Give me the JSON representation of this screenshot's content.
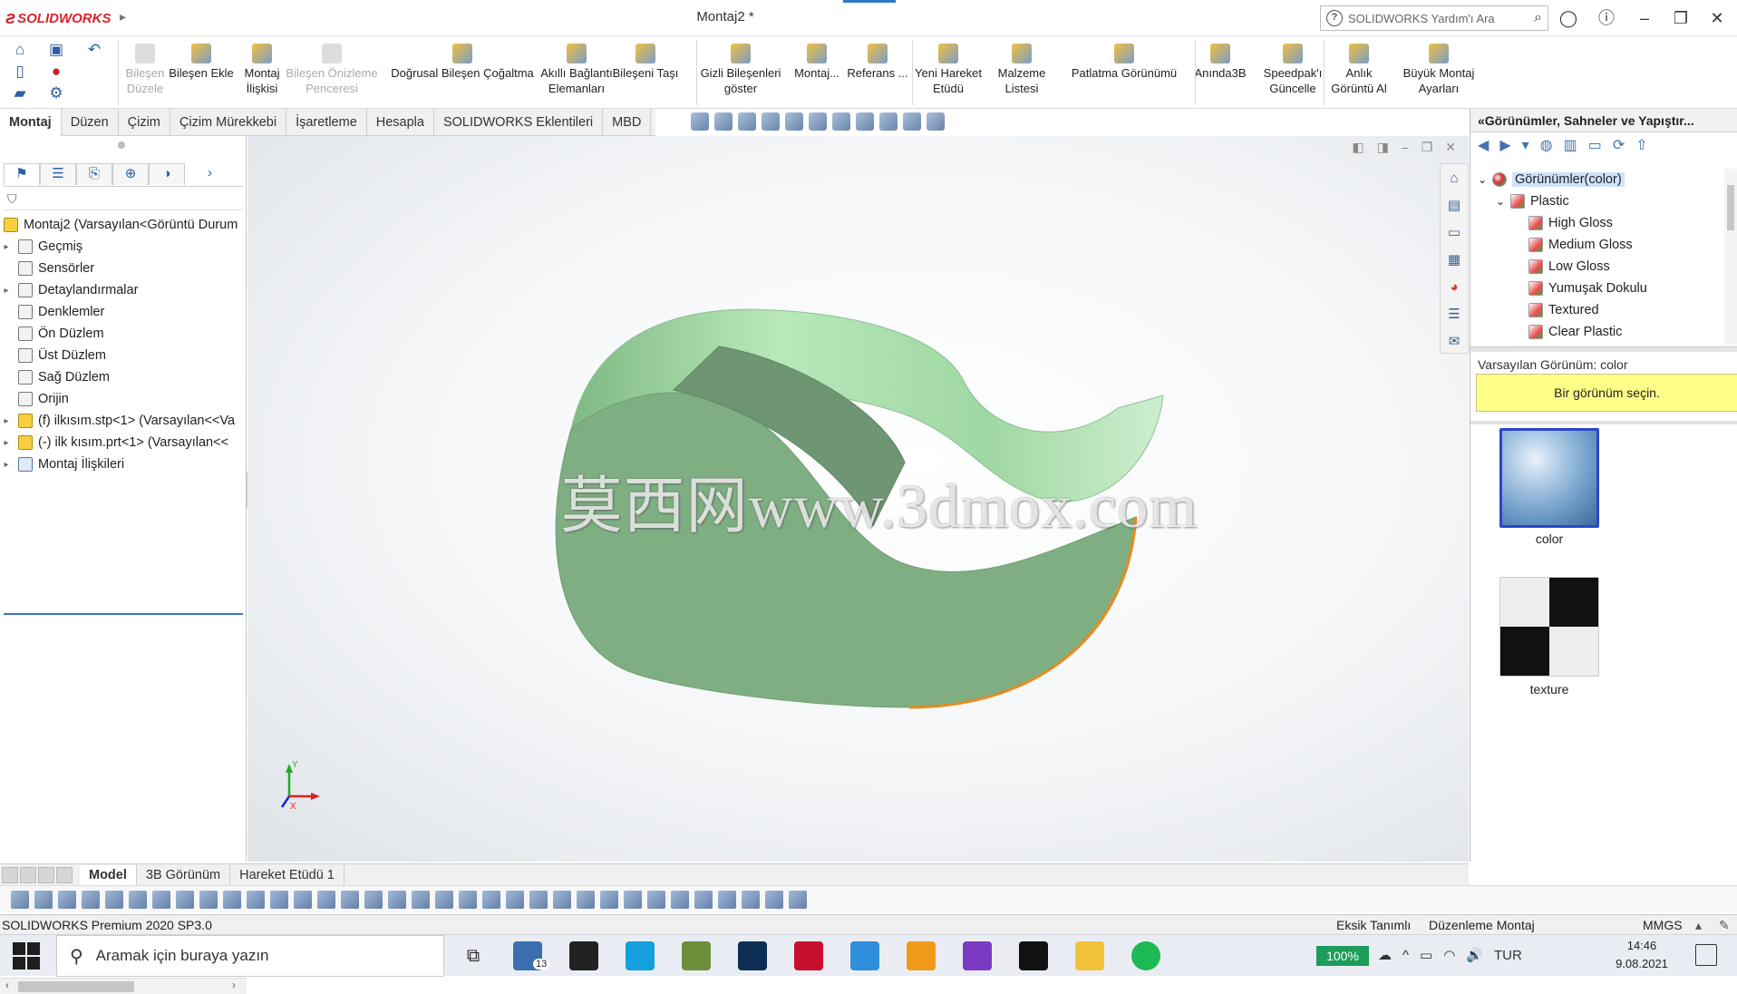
{
  "app": {
    "brand": "SOLIDWORKS",
    "doc_title": "Montaj2 *",
    "search_placeholder": "SOLIDWORKS Yardım'ı Ara"
  },
  "ribbon": {
    "buttons": [
      {
        "label": "Bileşen\nDüzele",
        "disabled": true
      },
      {
        "label": "Bileşen Ekle",
        "disabled": false
      },
      {
        "label": "Montaj\nİlişkisi",
        "disabled": false
      },
      {
        "label": "Bileşen Önizleme\nPenceresi",
        "disabled": true
      },
      {
        "label": "Doğrusal Bileşen Çoğaltma",
        "disabled": false
      },
      {
        "label": "Akıllı Bağlantı\nElemanları",
        "disabled": false
      },
      {
        "label": "Bileşeni Taşı",
        "disabled": false
      },
      {
        "label": "Gizli Bileşenleri\ngöster",
        "disabled": false
      },
      {
        "label": "Montaj...",
        "disabled": false
      },
      {
        "label": "Referans ...",
        "disabled": false
      },
      {
        "label": "Yeni Hareket\nEtüdü",
        "disabled": false
      },
      {
        "label": "Malzeme\nListesi",
        "disabled": false
      },
      {
        "label": "Patlatma Görünümü",
        "disabled": false
      },
      {
        "label": "Anında3B",
        "disabled": false
      },
      {
        "label": "Speedpak'ı\nGüncelle",
        "disabled": false
      },
      {
        "label": "Anlık\nGörüntü Al",
        "disabled": false
      },
      {
        "label": "Büyük Montaj\nAyarları",
        "disabled": false
      }
    ]
  },
  "command_tabs": [
    "Montaj",
    "Düzen",
    "Çizim",
    "Çizim Mürekkebi",
    "İşaretleme",
    "Hesapla",
    "SOLIDWORKS Eklentileri",
    "MBD"
  ],
  "feature_tree": {
    "root": "Montaj2  (Varsayılan<Görüntü Durum",
    "items": [
      {
        "label": "Geçmiş",
        "expandable": true
      },
      {
        "label": "Sensörler",
        "expandable": false
      },
      {
        "label": "Detaylandırmalar",
        "expandable": true
      },
      {
        "label": "Denklemler",
        "expandable": false
      },
      {
        "label": "Ön Düzlem",
        "expandable": false
      },
      {
        "label": "Üst Düzlem",
        "expandable": false
      },
      {
        "label": "Sağ Düzlem",
        "expandable": false
      },
      {
        "label": "Orijin",
        "expandable": false
      },
      {
        "label": "(f) ilkısım.stp<1> (Varsayılan<<Va",
        "expandable": true
      },
      {
        "label": "(-) ilk kısım.prt<1> (Varsayılan<<",
        "expandable": true
      },
      {
        "label": "Montaj İlişkileri",
        "expandable": true
      }
    ]
  },
  "viewport": {
    "watermark": "莫西网www.3dmox.com",
    "triad_x": "X",
    "triad_y": "Y",
    "model_color": "#9ccf9c"
  },
  "right_panel": {
    "header": "«Görünümler, Sahneler ve Yapıştır...",
    "tree": [
      {
        "label": "Görünümler(color)",
        "level": 0
      },
      {
        "label": "Plastic",
        "level": 1
      },
      {
        "label": "High Gloss",
        "level": 2
      },
      {
        "label": "Medium Gloss",
        "level": 2
      },
      {
        "label": "Low Gloss",
        "level": 2
      },
      {
        "label": "Yumuşak Dokulu",
        "level": 2
      },
      {
        "label": "Textured",
        "level": 2
      },
      {
        "label": "Clear Plastic",
        "level": 2
      }
    ],
    "default_appearance": "Varsayılan Görünüm: color",
    "prompt": "Bir görünüm seçin.",
    "thumbnails": [
      {
        "label": "color"
      },
      {
        "label": "texture"
      }
    ]
  },
  "bottom_tabs": [
    "Model",
    "3B Görünüm",
    "Hareket Etüdü 1"
  ],
  "status": {
    "product": "SOLIDWORKS Premium 2020 SP3.0",
    "definition": "Eksik Tanımlı",
    "mode": "Düzenleme Montaj",
    "units": "MMGS"
  },
  "taskbar": {
    "search_placeholder": "Aramak için buraya yazın",
    "mail_badge": "13",
    "battery": "100%",
    "language": "TUR",
    "time": "14:46",
    "date": "9.08.2021"
  }
}
